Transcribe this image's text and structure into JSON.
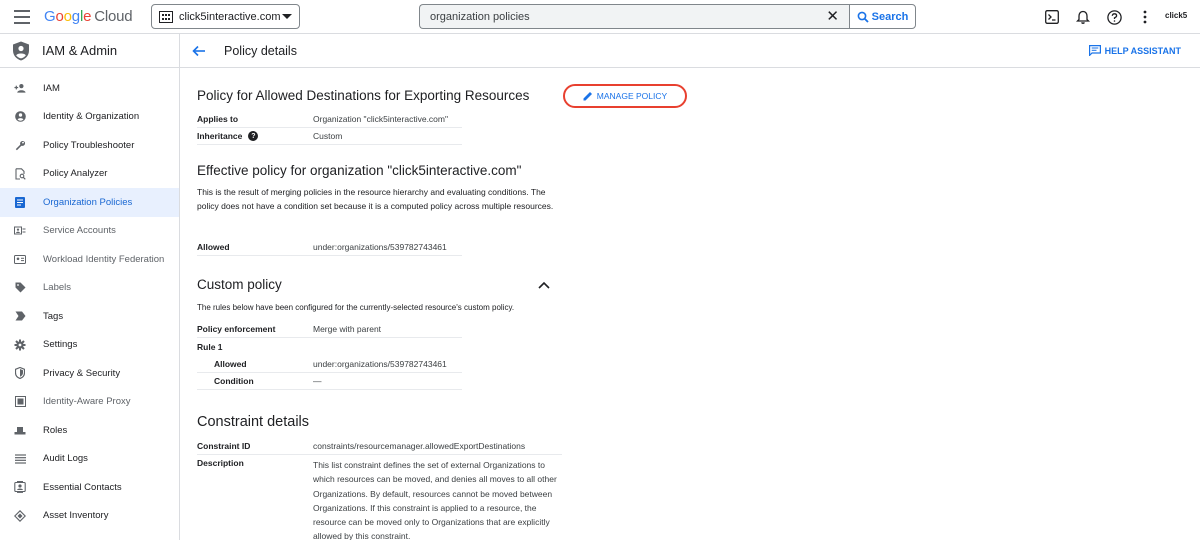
{
  "topbar": {
    "logo_google": [
      "G",
      "o",
      "o",
      "g",
      "l",
      "e"
    ],
    "logo_cloud": "Cloud",
    "project": "click5interactive.com",
    "search_value": "organization policies",
    "search_button": "Search",
    "account": "click5"
  },
  "sidebar": {
    "title": "IAM & Admin",
    "items": [
      {
        "label": "IAM",
        "icon": "person-add-icon"
      },
      {
        "label": "Identity & Organization",
        "icon": "account-circle-icon"
      },
      {
        "label": "Policy Troubleshooter",
        "icon": "wrench-icon"
      },
      {
        "label": "Policy Analyzer",
        "icon": "document-search-icon"
      },
      {
        "label": "Organization Policies",
        "icon": "list-doc-icon",
        "active": true
      },
      {
        "label": "Service Accounts",
        "icon": "service-account-icon",
        "dim": true
      },
      {
        "label": "Workload Identity Federation",
        "icon": "id-card-icon",
        "dim": true
      },
      {
        "label": "Labels",
        "icon": "label-icon",
        "dim": true
      },
      {
        "label": "Tags",
        "icon": "tag-arrow-icon"
      },
      {
        "label": "Settings",
        "icon": "gear-icon"
      },
      {
        "label": "Privacy & Security",
        "icon": "shield-icon"
      },
      {
        "label": "Identity-Aware Proxy",
        "icon": "proxy-icon",
        "dim": true
      },
      {
        "label": "Roles",
        "icon": "hat-icon"
      },
      {
        "label": "Audit Logs",
        "icon": "lines-icon"
      },
      {
        "label": "Essential Contacts",
        "icon": "contact-card-icon"
      },
      {
        "label": "Asset Inventory",
        "icon": "diamond-icon"
      }
    ]
  },
  "header": {
    "title": "Policy details",
    "help_assistant": "HELP ASSISTANT"
  },
  "policy": {
    "title": "Policy for Allowed Destinations for Exporting Resources",
    "manage_button": "MANAGE POLICY",
    "applies_to_label": "Applies to",
    "applies_to_value": "Organization \"click5interactive.com\"",
    "inheritance_label": "Inheritance",
    "inheritance_value": "Custom"
  },
  "effective": {
    "title": "Effective policy for organization \"click5interactive.com\"",
    "description": "This is the result of merging policies in the resource hierarchy and evaluating conditions. The policy does not have a condition set because it is a computed policy across multiple resources.",
    "allowed_label": "Allowed",
    "allowed_value": "under:organizations/539782743461"
  },
  "custom": {
    "title": "Custom policy",
    "description": "The rules below have been configured for the currently-selected resource's custom policy.",
    "enforcement_label": "Policy enforcement",
    "enforcement_value": "Merge with parent",
    "rule_label": "Rule 1",
    "allowed_label": "Allowed",
    "allowed_value": "under:organizations/539782743461",
    "condition_label": "Condition",
    "condition_value": "—"
  },
  "constraint": {
    "title": "Constraint details",
    "id_label": "Constraint ID",
    "id_value": "constraints/resourcemanager.allowedExportDestinations",
    "description_label": "Description",
    "description_value": "This list constraint defines the set of external Organizations to which resources can be moved, and denies all moves to all other Organizations. By default, resources cannot be moved between Organizations. If this constraint is applied to a resource, the resource can be moved only to Organizations that are explicitly allowed by this constraint."
  },
  "colors": {
    "accent": "#1a73e8",
    "active_bg": "#e8f0fe",
    "highlight_ring": "#e8402f"
  }
}
